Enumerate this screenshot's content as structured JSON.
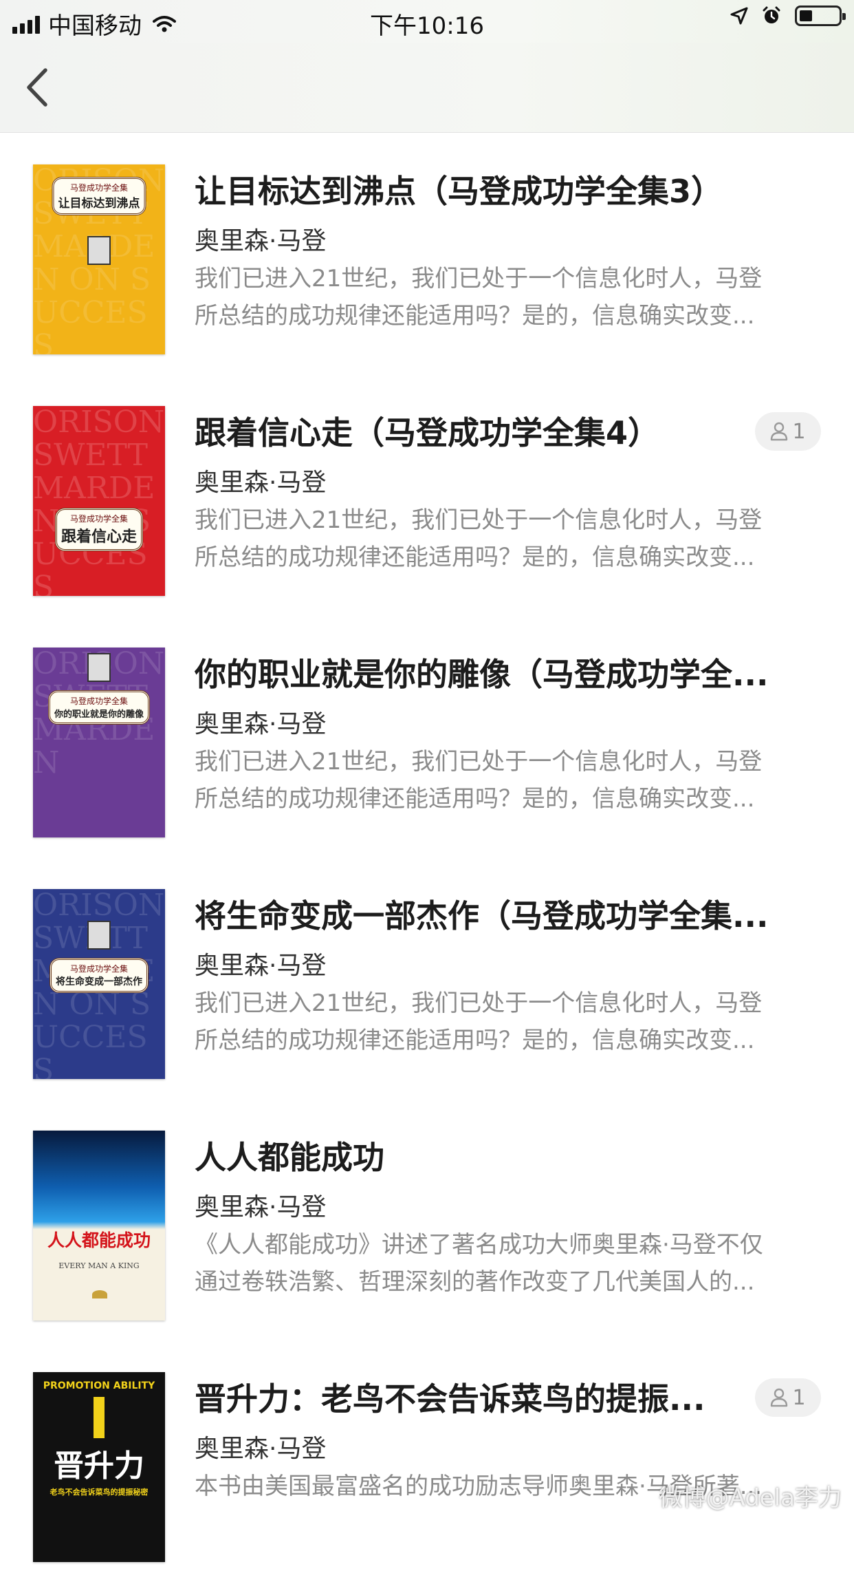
{
  "status_bar": {
    "carrier": "中国移动",
    "time": "下午10:16",
    "icons": [
      "signal-icon",
      "wifi-icon",
      "location-arrow-icon",
      "alarm-icon",
      "battery-icon"
    ]
  },
  "nav": {
    "back_icon": "chevron-left-icon"
  },
  "books": [
    {
      "title": "让目标达到沸点（马登成功学全集3）",
      "author": "奥里森·马登",
      "desc_line1": "我们已进入21世纪，我们已处于一个信息化时人，马登",
      "desc_line2": "所总结的成功规律还能适用吗？是的，信息确实改变...",
      "badge": null,
      "cover": {
        "bg": "#f2b318",
        "series": "马登成功学全集",
        "name": "让目标达到沸点",
        "bgtext": "ORISON SWETT MARDEN ON SUCCESS"
      }
    },
    {
      "title": "跟着信心走（马登成功学全集4）",
      "author": "奥里森·马登",
      "desc_line1": "我们已进入21世纪，我们已处于一个信息化时人，马登",
      "desc_line2": "所总结的成功规律还能适用吗？是的，信息确实改变...",
      "badge": "1",
      "cover": {
        "bg": "#d81e25",
        "series": "马登成功学全集",
        "name": "跟着信心走",
        "bgtext": "ORISON SWETT MARDEN ON SUCCESS"
      }
    },
    {
      "title": "你的职业就是你的雕像（马登成功学全...",
      "author": "奥里森·马登",
      "desc_line1": "我们已进入21世纪，我们已处于一个信息化时人，马登",
      "desc_line2": "所总结的成功规律还能适用吗？是的，信息确实改变...",
      "badge": null,
      "cover": {
        "bg": "#6a3c95",
        "series": "马登成功学全集",
        "name": "你的职业就是你的雕像",
        "bgtext": "ORISON SWETT MARDEN"
      }
    },
    {
      "title": "将生命变成一部杰作（马登成功学全集...",
      "author": "奥里森·马登",
      "desc_line1": "我们已进入21世纪，我们已处于一个信息化时人，马登",
      "desc_line2": "所总结的成功规律还能适用吗？是的，信息确实改变...",
      "badge": null,
      "cover": {
        "bg": "#2c3b8a",
        "series": "马登成功学全集",
        "name": "将生命变成一部杰作",
        "bgtext": "ORISON SWETT MARDEN ON SUCCESS"
      }
    },
    {
      "title": "人人都能成功",
      "author": "奥里森·马登",
      "desc_line1": "《人人都能成功》讲述了著名成功大师奥里森·马登不仅",
      "desc_line2": "通过卷轶浩繁、哲理深刻的著作改变了几代美国人的...",
      "badge": null,
      "cover": {
        "bg": "#0f5fb0",
        "name": "人人都能成功",
        "sub": "EVERY MAN A KING"
      }
    },
    {
      "title": "晋升力：老鸟不会告诉菜鸟的提振...",
      "author": "奥里森·马登",
      "desc_line1": "本书由美国最富盛名的成功励志导师奥里森·马登所著...",
      "desc_line2": "",
      "badge": "1",
      "cover": {
        "bg": "#111111",
        "name": "晋升力",
        "arc": "PROMOTION ABILITY",
        "sub": "老鸟不会告诉菜鸟的提振秘密"
      }
    }
  ],
  "watermark": "微博@Adela李力"
}
